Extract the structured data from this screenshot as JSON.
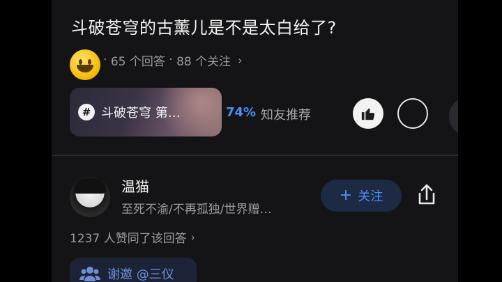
{
  "question": {
    "title": "斗破苍穹的古薰儿是不是太白给了?",
    "meta_prefix": "·",
    "answers": "65 个回答",
    "meta_sep": "·",
    "follows": "88 个关注",
    "chevron": "›"
  },
  "topic": {
    "hash_symbol": "#",
    "name": "斗破苍穹 第…",
    "recommend_percent": "74%",
    "recommend_label": "知友推荐"
  },
  "answer": {
    "author_name": "温猫",
    "author_bio": "至死不渝/不再孤独/世界赠…",
    "follow_plus": "+",
    "follow_label": "关注",
    "likes_text": "1237 人赞同了该回答",
    "likes_chevron": "›",
    "invite_label": "谢邀 @三仪"
  },
  "colors": {
    "accent_blue": "#4f8df7",
    "background": "#141416",
    "follow_bg": "#1d2a44"
  },
  "icons": {
    "emoji": "smiley-emoji-icon",
    "topic": "hash-icon",
    "thumb": "thumbs-up-icon",
    "expand": "chevron-down-icon",
    "share": "share-icon",
    "invite": "group-icon"
  }
}
